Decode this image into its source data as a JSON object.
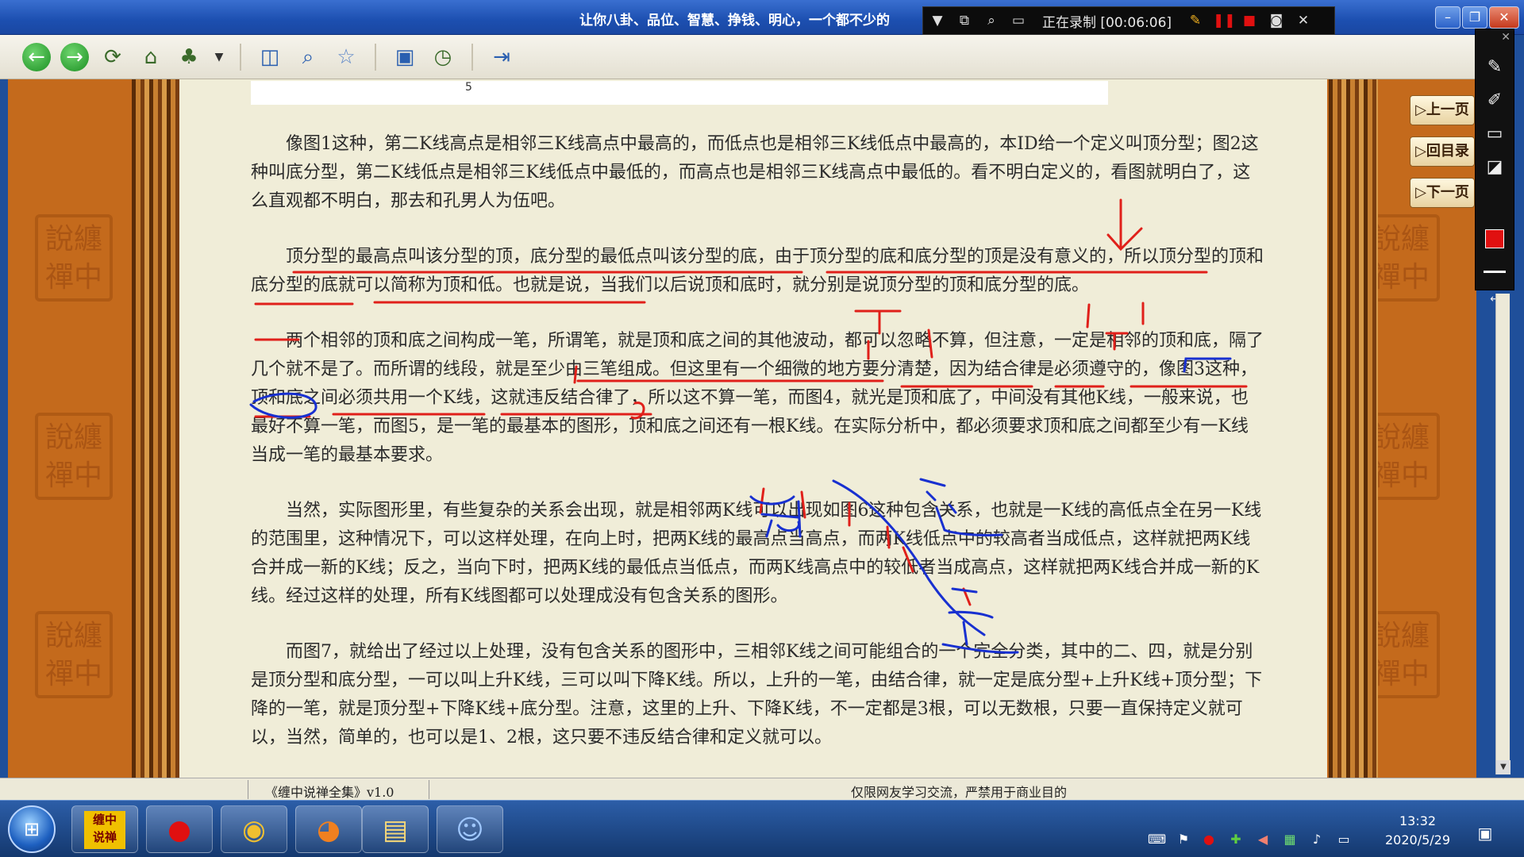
{
  "window": {
    "title": "让你八卦、品位、智慧、挣钱、明心，一个都不少的",
    "minimize": "–",
    "maximize": "❐",
    "close": "✕"
  },
  "recorder": {
    "status": "正在录制 [00:06:06]"
  },
  "toolbar": {
    "icons": [
      "back-icon",
      "forward-icon",
      "refresh-icon",
      "home-icon",
      "tree-icon",
      "dropdown-icon",
      "panel-icon",
      "search-icon",
      "favorite-icon",
      "view-icon",
      "history-icon",
      "exit-icon"
    ]
  },
  "page": {
    "number": "5",
    "paragraphs": [
      "像图1这种，第二K线高点是相邻三K线高点中最高的，而低点也是相邻三K线低点中最高的，本ID给一个定义叫顶分型；图2这种叫底分型，第二K线低点是相邻三K线低点中最低的，而高点也是相邻三K线高点中最低的。看不明白定义的，看图就明白了，这么直观都不明白，那去和孔男人为伍吧。",
      "顶分型的最高点叫该分型的顶，底分型的最低点叫该分型的底，由于顶分型的底和底分型的顶是没有意义的，所以顶分型的顶和底分型的底就可以简称为顶和低。也就是说，当我们以后说顶和底时，就分别是说顶分型的顶和底分型的底。",
      "两个相邻的顶和底之间构成一笔，所谓笔，就是顶和底之间的其他波动，都可以忽略不算，但注意，一定是相邻的顶和底，隔了几个就不是了。而所谓的线段，就是至少由三笔组成。但这里有一个细微的地方要分清楚，因为结合律是必须遵守的，像图3这种，顶和底之间必须共用一个K线，这就违反结合律了，所以这不算一笔，而图4，就光是顶和底了，中间没有其他K线，一般来说，也最好不算一笔，而图5，是一笔的最基本的图形，顶和底之间还有一根K线。在实际分析中，都必须要求顶和底之间都至少有一K线当成一笔的最基本要求。",
      "当然，实际图形里，有些复杂的关系会出现，就是相邻两K线可以出现如图6这种包含关系，也就是一K线的高低点全在另一K线的范围里，这种情况下，可以这样处理，在向上时，把两K线的最高点当高点，而两K线低点中的较高者当成低点，这样就把两K线合并成一新的K线；反之，当向下时，把两K线的最低点当低点，而两K线高点中的较低者当成高点，这样就把两K线合并成一新的K线。经过这样的处理，所有K线图都可以处理成没有包含关系的图形。",
      "而图7，就给出了经过以上处理，没有包含关系的图形中，三相邻K线之间可能组合的一个完全分类，其中的二、四，就是分别是顶分型和底分型，一可以叫上升K线，三可以叫下降K线。所以，上升的一笔，由结合律，就一定是底分型+上升K线+顶分型；下降的一笔，就是顶分型+下降K线+底分型。注意，这里的上升、下降K线，不一定都是3根，可以无数根，只要一直保持定义就可以，当然，简单的，也可以是1、2根，这只要不违反结合律和定义就可以。"
    ]
  },
  "nav": {
    "prev": "▷上一页",
    "toc": "▷回目录",
    "next": "▷下一页"
  },
  "watermark": {
    "text": "說纏禪中"
  },
  "statusbar": {
    "left": "《缠中说禅全集》v1.0",
    "right": "仅限网友学习交流，严禁用于商业目的"
  },
  "taskbar": {
    "apps": [
      "缠中说禅",
      "record-icon",
      "chrome-icon",
      "firefox-icon",
      "folder-icon",
      "assistant-icon"
    ],
    "app_label": "缠中\n说禅",
    "time": "13:32",
    "date": "2020/5/29"
  },
  "ink": {
    "colors": {
      "red": "#e0201a",
      "blue": "#1830d0"
    }
  }
}
